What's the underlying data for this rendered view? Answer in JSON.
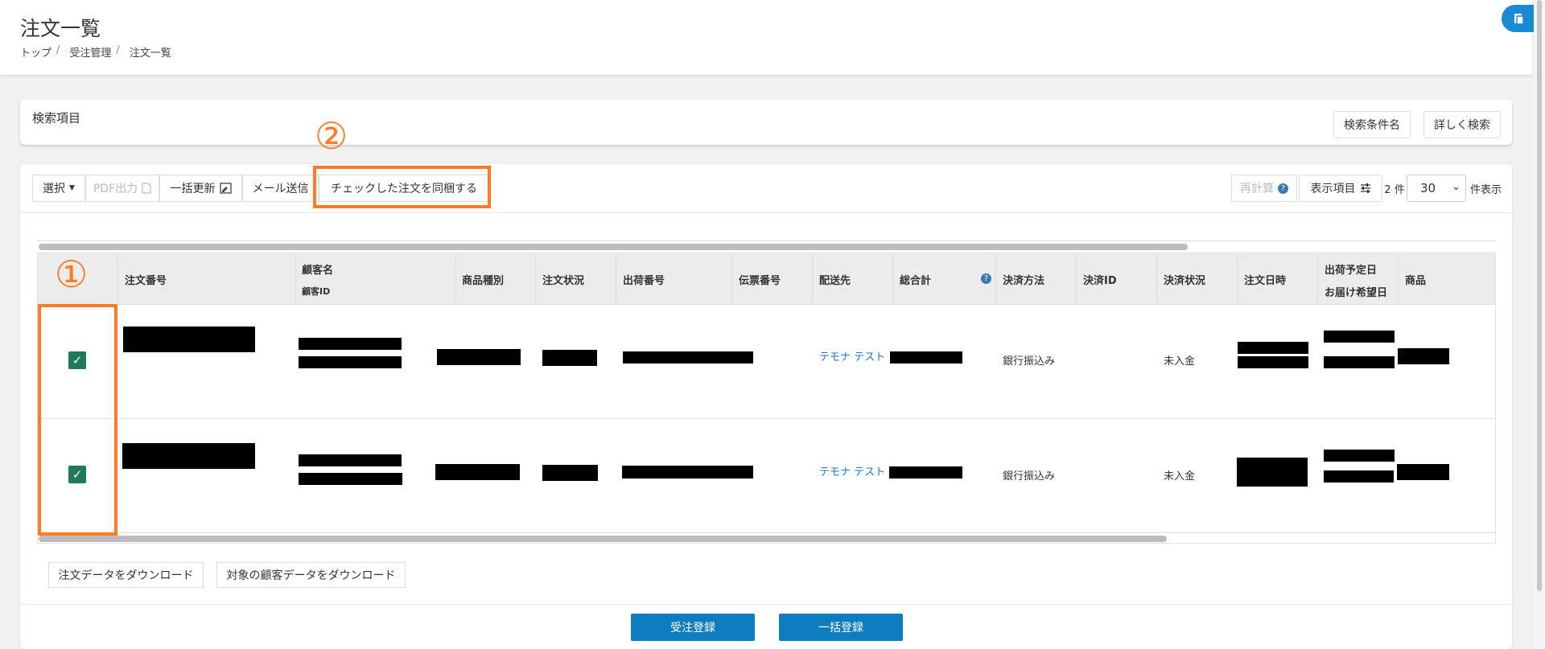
{
  "header": {
    "title": "注文一覧",
    "breadcrumb": [
      "トップ",
      "受注管理",
      "注文一覧"
    ]
  },
  "search": {
    "title": "検索項目",
    "conditions_btn": "検索条件名",
    "detail_btn": "詳しく検索"
  },
  "toolbar": {
    "select": "選択",
    "pdf": "PDF出力",
    "bulk_update": "一括更新",
    "send_mail": "メール送信",
    "bundle": "チェックした注文を同梱する",
    "recalc": "再計算",
    "display_items": "表示項目",
    "count_text": "2 件",
    "per_page": "30",
    "per_page_suffix": "件表示"
  },
  "annotations": {
    "one": "①",
    "two": "②"
  },
  "table": {
    "headers": {
      "order_no": "注文番号",
      "customer_name": "顧客名",
      "customer_id": "顧客ID",
      "product_type": "商品種別",
      "order_status": "注文状況",
      "shipment_no": "出荷番号",
      "slip_no": "伝票番号",
      "delivery": "配送先",
      "total": "総合計",
      "payment_method": "決済方法",
      "payment_id": "決済ID",
      "payment_status": "決済状況",
      "order_date": "注文日時",
      "ship_date": "出荷予定日",
      "delivery_date": "お届け希望日",
      "product": "商品"
    },
    "rows": [
      {
        "delivery": "テモナ テスト",
        "payment_method": "銀行振込み",
        "payment_status": "未入金"
      },
      {
        "delivery": "テモナ テスト",
        "payment_method": "銀行振込み",
        "payment_status": "未入金"
      }
    ]
  },
  "downloads": {
    "orders": "注文データをダウンロード",
    "customers": "対象の顧客データをダウンロード"
  },
  "footer": {
    "register": "受注登録",
    "bulk_register": "一括登録"
  },
  "colors": {
    "accent": "#ff7a26",
    "primary": "#0e7dbf",
    "checkbox": "#1e7a57",
    "link": "#1a76c7"
  }
}
